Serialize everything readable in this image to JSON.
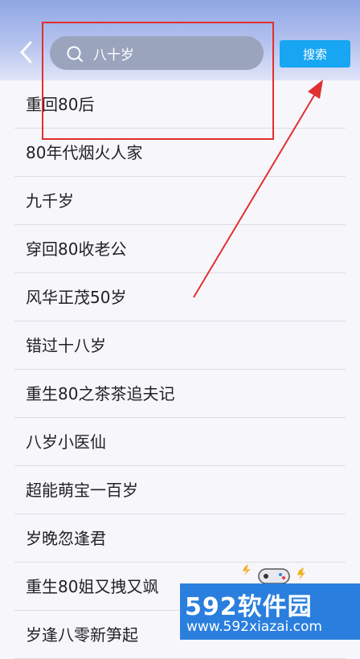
{
  "header": {
    "back_icon": "chevron-left-icon",
    "search_icon": "search-icon",
    "search_value": "八十岁",
    "search_button_label": "搜索",
    "background_color": "#a9b8ec",
    "search_box_color": "#9aa4bd",
    "button_color": "#18a6f3"
  },
  "results": [
    {
      "label": "重回80后"
    },
    {
      "label": "80年代烟火人家"
    },
    {
      "label": "九千岁"
    },
    {
      "label": "穿回80收老公"
    },
    {
      "label": "风华正茂50岁"
    },
    {
      "label": "错过十八岁"
    },
    {
      "label": "重生80之茶茶追夫记"
    },
    {
      "label": "八岁小医仙"
    },
    {
      "label": "超能萌宝一百岁"
    },
    {
      "label": "岁晚忽逢君"
    },
    {
      "label": "重生80姐又拽又飒"
    },
    {
      "label": "岁逢八零新笋起"
    }
  ],
  "annotation": {
    "color": "#e03030"
  },
  "watermark": {
    "logo_text": "592软件园",
    "url_text": "www.592xiazai.com"
  }
}
